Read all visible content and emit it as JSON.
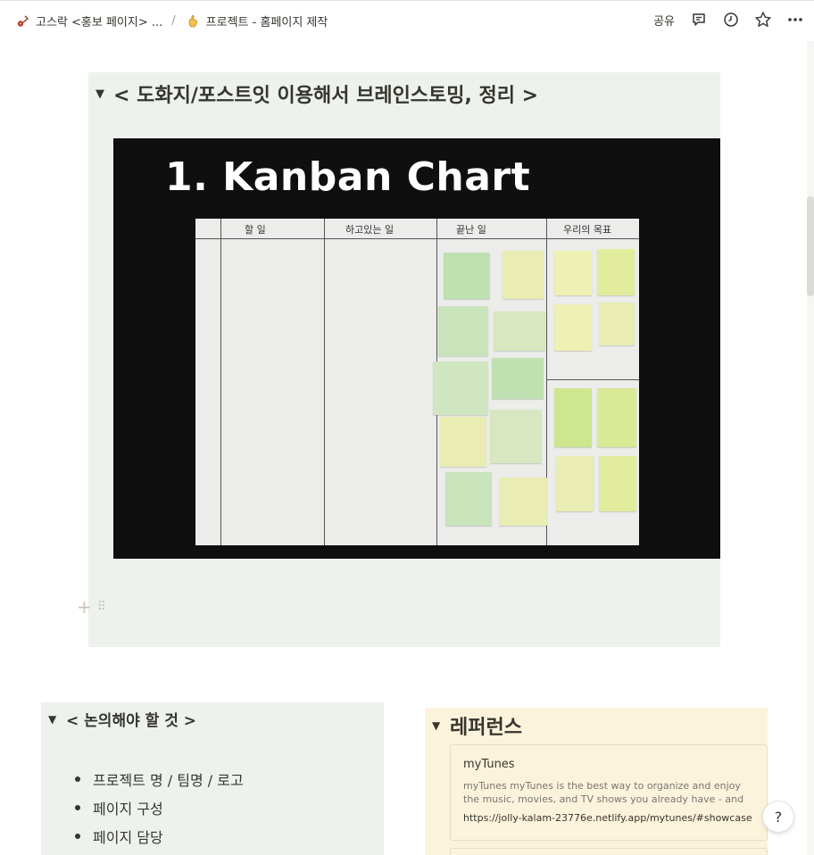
{
  "breadcrumb": {
    "items": [
      {
        "label": "고스락 <홍보 페이지> ...",
        "icon": "guitar-icon"
      },
      {
        "label": "프로젝트 - 홈페이지 제작",
        "icon": "pointing-hand-icon"
      }
    ],
    "separator": "/"
  },
  "topbar": {
    "share_label": "공유",
    "icons": [
      "comment-icon",
      "clock-icon",
      "star-icon",
      "more-icon"
    ]
  },
  "toggle_main": {
    "title": "< 도화지/포스트잇 이용해서 브레인스토밍, 정리 >",
    "image": {
      "heading": "1. Kanban Chart",
      "columns": [
        "할 일",
        "하고있는 일",
        "끝난 일",
        "우리의 목표"
      ]
    }
  },
  "discuss": {
    "title": "< 논의해야 할 것 >",
    "items": [
      "프로젝트 명 / 팀명 / 로고",
      "페이지 구성",
      "페이지 담당"
    ]
  },
  "reference": {
    "title": "레퍼런스",
    "bookmark": {
      "title": "myTunes",
      "description": "myTunes myTunes is the best way to organize and enjoy the music, movies, and TV shows you already have - and shop for",
      "url": "https://jolly-kalam-23776e.netlify.app/mytunes/#showcase"
    }
  },
  "help_label": "?",
  "colors": {
    "green_bg": "#edf3ec",
    "yellow_bg": "#fbf3db",
    "text": "#37352f"
  }
}
